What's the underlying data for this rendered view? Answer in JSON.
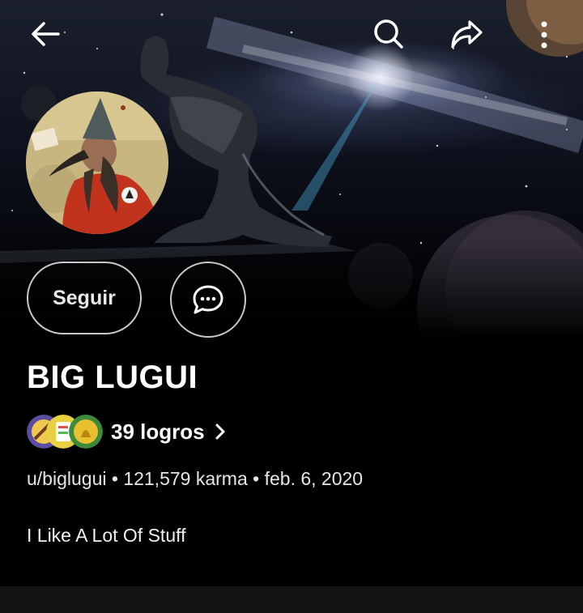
{
  "topbar": {
    "back_icon": "arrow-left-icon",
    "search_icon": "search-icon",
    "share_icon": "share-icon",
    "more_icon": "more-vertical-icon"
  },
  "profile": {
    "follow_label": "Seguir",
    "chat_icon": "chat-bubble-icon",
    "display_name": "BIG LUGUI",
    "achievements_label": "39 logros",
    "meta": {
      "handle": "u/biglugui",
      "separator": "•",
      "karma": "121,579 karma",
      "joined": "feb. 6, 2020"
    },
    "bio": "I Like A Lot Of Stuff"
  },
  "colors": {
    "background": "#000000",
    "button_border": "#c8c8c8",
    "text": "#ffffff",
    "bottom_strip": "#141414"
  }
}
